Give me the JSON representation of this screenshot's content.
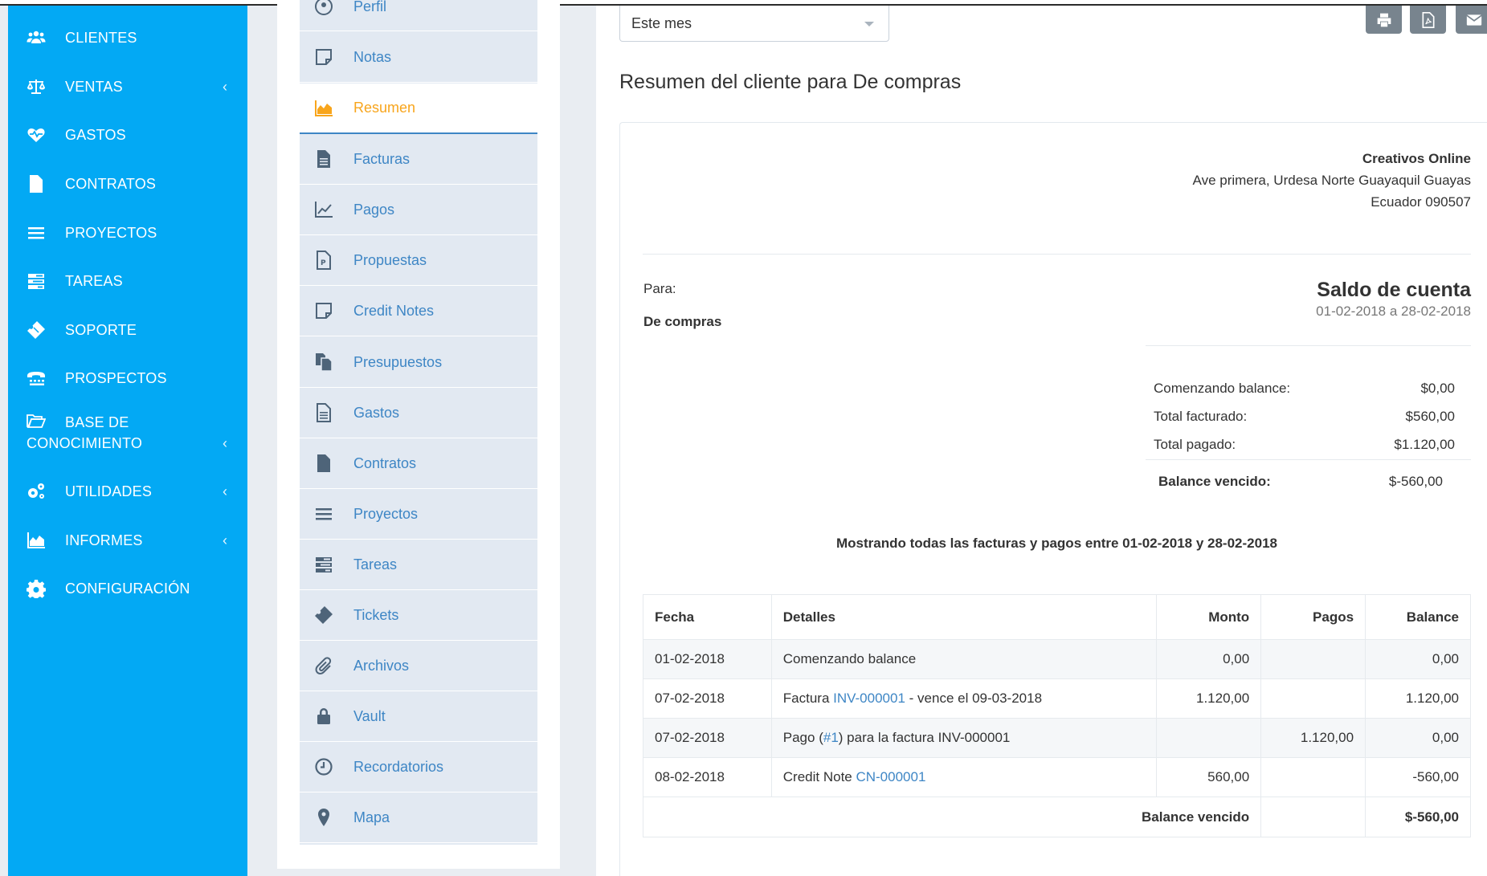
{
  "sidebar": {
    "items": [
      {
        "label": "CLIENTES",
        "icon": "users-icon"
      },
      {
        "label": "VENTAS",
        "icon": "balance-scale-icon",
        "chevron": "‹"
      },
      {
        "label": "GASTOS",
        "icon": "heartbeat-icon"
      },
      {
        "label": "CONTRATOS",
        "icon": "file-icon"
      },
      {
        "label": "PROYECTOS",
        "icon": "bars-icon"
      },
      {
        "label": "TAREAS",
        "icon": "tasks-icon"
      },
      {
        "label": "SOPORTE",
        "icon": "ticket-icon"
      },
      {
        "label": "PROSPECTOS",
        "icon": "tty-icon"
      },
      {
        "label": "BASE DE",
        "label2": "CONOCIMIENTO",
        "icon": "folder-open-icon",
        "chevron": "‹"
      },
      {
        "label": "UTILIDADES",
        "icon": "cogs-icon",
        "chevron": "‹"
      },
      {
        "label": "INFORMES",
        "icon": "area-chart-icon",
        "chevron": "‹"
      },
      {
        "label": "CONFIGURACIÓN",
        "icon": "cog-icon"
      }
    ]
  },
  "profile_nav": {
    "items": [
      {
        "label": "Perfil",
        "icon": "user-circle-icon"
      },
      {
        "label": "Notas",
        "icon": "sticky-note-icon"
      },
      {
        "label": "Resumen",
        "icon": "area-chart-icon",
        "active": true
      },
      {
        "label": "Facturas",
        "icon": "file-text-icon"
      },
      {
        "label": "Pagos",
        "icon": "line-chart-icon"
      },
      {
        "label": "Propuestas",
        "icon": "file-powerpoint-icon"
      },
      {
        "label": "Credit Notes",
        "icon": "sticky-note-icon"
      },
      {
        "label": "Presupuestos",
        "icon": "clone-icon"
      },
      {
        "label": "Gastos",
        "icon": "file-text-o-icon"
      },
      {
        "label": "Contratos",
        "icon": "file-icon"
      },
      {
        "label": "Proyectos",
        "icon": "bars-icon"
      },
      {
        "label": "Tareas",
        "icon": "tasks-icon"
      },
      {
        "label": "Tickets",
        "icon": "ticket-icon"
      },
      {
        "label": "Archivos",
        "icon": "paperclip-icon"
      },
      {
        "label": "Vault",
        "icon": "lock-icon"
      },
      {
        "label": "Recordatorios",
        "icon": "clock-icon"
      },
      {
        "label": "Mapa",
        "icon": "map-marker-icon"
      }
    ]
  },
  "toolbar": {
    "period_select": "Este mes",
    "buttons": [
      "print-icon",
      "pdf-icon",
      "envelope-icon"
    ]
  },
  "page_title": "Resumen del cliente para De compras",
  "company": {
    "name": "Creativos Online",
    "address": "Ave primera, Urdesa Norte Guayaquil Guayas",
    "country_zip": "Ecuador 090507"
  },
  "statement": {
    "to_label": "Para:",
    "client_name": "De compras",
    "title": "Saldo de cuenta",
    "range": "01-02-2018 a 28-02-2018",
    "summary": [
      {
        "label": "Comenzando balance:",
        "value": "$0,00"
      },
      {
        "label": "Total facturado:",
        "value": "$560,00"
      },
      {
        "label": "Total pagado:",
        "value": "$1.120,00"
      },
      {
        "label": "Balance vencido:",
        "value": "$-560,00"
      }
    ],
    "showing_text": "Mostrando todas las facturas y pagos entre 01-02-2018 y 28-02-2018"
  },
  "table": {
    "headers": [
      "Fecha",
      "Detalles",
      "Monto",
      "Pagos",
      "Balance"
    ],
    "rows": [
      {
        "date": "01-02-2018",
        "pre": "Comenzando balance",
        "link": "",
        "post": "",
        "amount": "0,00",
        "payment": "",
        "balance": "0,00"
      },
      {
        "date": "07-02-2018",
        "pre": "Factura ",
        "link": "INV-000001",
        "post": " - vence el 09-03-2018",
        "amount": "1.120,00",
        "payment": "",
        "balance": "1.120,00"
      },
      {
        "date": "07-02-2018",
        "pre": "Pago (",
        "link": "#1",
        "post": ") para la factura INV-000001",
        "amount": "",
        "payment": "1.120,00",
        "balance": "0,00"
      },
      {
        "date": "08-02-2018",
        "pre": "Credit Note ",
        "link": "CN-000001",
        "post": "",
        "amount": "560,00",
        "payment": "",
        "balance": "-560,00"
      }
    ],
    "footer_label": "Balance vencido",
    "footer_value": "$-560,00"
  },
  "colors": {
    "sidebar_bg": "#03a9f4",
    "link": "#3e86c5",
    "active_nav": "#f8a51c",
    "nav_bg": "#e2e9f2",
    "toolbar_btn": "#78848e"
  }
}
